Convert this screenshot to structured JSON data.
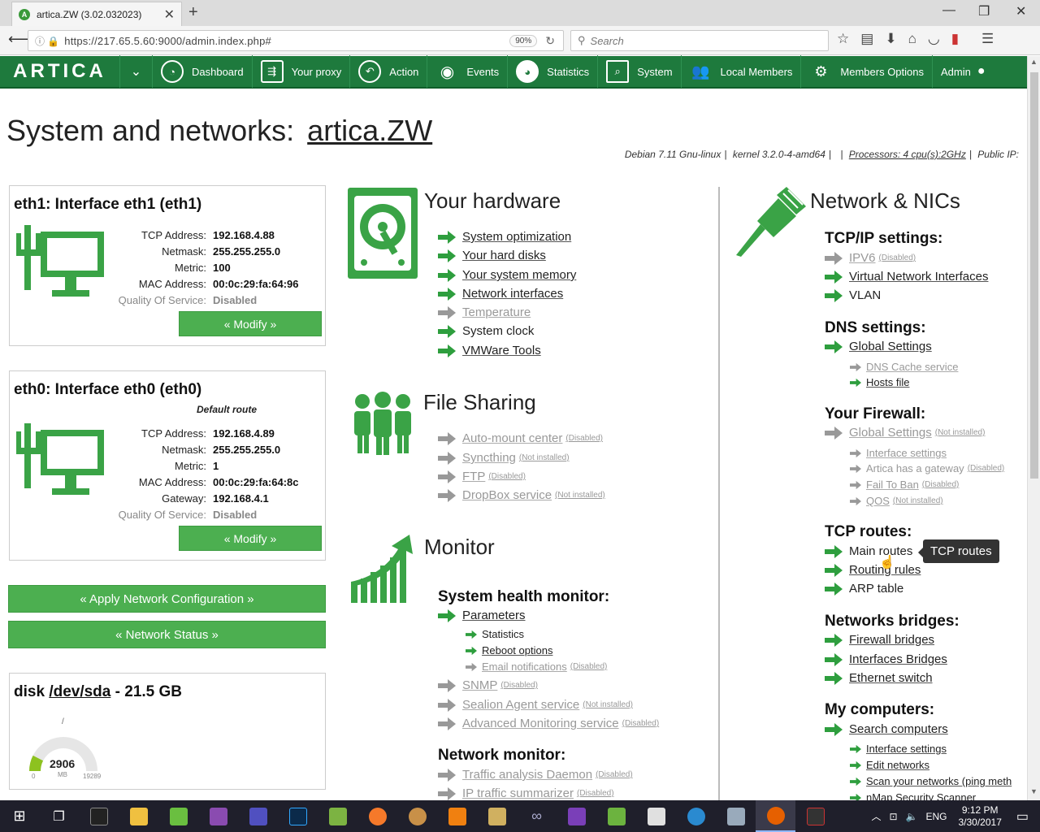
{
  "browser": {
    "tab_title": "artica.ZW (3.02.032023)",
    "url": "https://217.65.5.60:9000/admin.index.php#",
    "zoom": "90%",
    "search_placeholder": "Search"
  },
  "appnav": {
    "logo": "ARTICA",
    "items": [
      {
        "label": "Dashboard",
        "icon": "dashboard-icon"
      },
      {
        "label": "Your proxy",
        "icon": "proxy-icon"
      },
      {
        "label": "Action",
        "icon": "action-icon"
      },
      {
        "label": "Events",
        "icon": "events-icon"
      },
      {
        "label": "Statistics",
        "icon": "statistics-icon"
      },
      {
        "label": "System",
        "icon": "system-icon"
      },
      {
        "label": "Local Members",
        "icon": "local-members-icon"
      },
      {
        "label": "Members Options",
        "icon": "members-options-icon"
      },
      {
        "label": "Admin",
        "icon": "admin-icon"
      }
    ]
  },
  "page": {
    "title_prefix": "System and networks:",
    "hostname": "artica.ZW",
    "sysinfo": {
      "os": "Debian 7.11 Gnu-linux",
      "kernel": "kernel 3.2.0-4-amd64",
      "processors": "Processors: 4 cpu(s):2GHz",
      "public_ip": "Public IP:"
    }
  },
  "eth1": {
    "title": "eth1: Interface eth1 (eth1)",
    "rows": [
      {
        "k": "TCP Address:",
        "v": "192.168.4.88"
      },
      {
        "k": "Netmask:",
        "v": "255.255.255.0"
      },
      {
        "k": "Metric:",
        "v": "100"
      },
      {
        "k": "MAC Address:",
        "v": "00:0c:29:fa:64:96"
      },
      {
        "k": "Quality Of Service:",
        "v": "Disabled"
      }
    ],
    "modify": "« Modify »"
  },
  "eth0": {
    "title": "eth0: Interface eth0 (eth0)",
    "default_route": "Default route",
    "rows": [
      {
        "k": "TCP Address:",
        "v": "192.168.4.89"
      },
      {
        "k": "Netmask:",
        "v": "255.255.255.0"
      },
      {
        "k": "Metric:",
        "v": "1"
      },
      {
        "k": "MAC Address:",
        "v": "00:0c:29:fa:64:8c"
      },
      {
        "k": "Gateway:",
        "v": "192.168.4.1"
      },
      {
        "k": "Quality Of Service:",
        "v": "Disabled"
      }
    ],
    "modify": "« Modify »"
  },
  "buttons": {
    "apply": "« Apply Network Configuration »",
    "status": "« Network Status »"
  },
  "disk": {
    "title_prefix": "disk",
    "device": "/dev/sda",
    "title_suffix": "- 21.5 GB",
    "mount": "/",
    "used": "2906",
    "unit": "MB",
    "min": "0",
    "max": "19289",
    "fill_fraction": 0.15
  },
  "hardware": {
    "title": "Your hardware",
    "links": [
      {
        "label": "System optimization",
        "disabled": false
      },
      {
        "label": "Your hard disks",
        "disabled": false
      },
      {
        "label": "Your system memory",
        "disabled": false
      },
      {
        "label": "Network interfaces",
        "disabled": false
      },
      {
        "label": "Temperature",
        "disabled": true
      },
      {
        "label": "System clock",
        "disabled": false,
        "plain": true
      },
      {
        "label": "VMWare Tools",
        "disabled": false
      }
    ]
  },
  "filesharing": {
    "title": "File Sharing",
    "links": [
      {
        "label": "Auto-mount center",
        "tag": "(Disabled)"
      },
      {
        "label": "Syncthing",
        "tag": "(Not installed)"
      },
      {
        "label": "FTP",
        "tag": "(Disabled)"
      },
      {
        "label": "DropBox service",
        "tag": "(Not installed)"
      }
    ]
  },
  "monitor": {
    "title": "Monitor",
    "health_head": "System health monitor:",
    "parameters": "Parameters",
    "sub": [
      {
        "label": "Statistics",
        "disabled": false,
        "plain": true
      },
      {
        "label": "Reboot options",
        "disabled": false
      },
      {
        "label": "Email notifications",
        "disabled": true,
        "tag": "(Disabled)"
      }
    ],
    "more": [
      {
        "label": "SNMP",
        "tag": "(Disabled)"
      },
      {
        "label": "Sealion Agent service",
        "tag": "(Not installed)"
      },
      {
        "label": "Advanced Monitoring service",
        "tag": "(Disabled)"
      }
    ],
    "network_head": "Network monitor:",
    "net_links": [
      {
        "label": "Traffic analysis Daemon",
        "tag": "(Disabled)"
      },
      {
        "label": "IP traffic summarizer",
        "tag": "(Disabled)"
      }
    ]
  },
  "network": {
    "title": "Network & NICs",
    "tcpip_head": "TCP/IP settings:",
    "tcpip": [
      {
        "label": "IPV6",
        "tag": "(Disabled)",
        "disabled": true
      },
      {
        "label": "Virtual Network Interfaces",
        "disabled": false
      },
      {
        "label": "VLAN",
        "disabled": false,
        "plain": true
      }
    ],
    "dns_head": "DNS settings:",
    "dns_global": "Global Settings",
    "dns_sub": [
      {
        "label": "DNS Cache service",
        "disabled": true
      },
      {
        "label": "Hosts file",
        "disabled": false
      }
    ],
    "fw_head": "Your Firewall:",
    "fw_global": "Global Settings",
    "fw_global_tag": "(Not installed)",
    "fw_sub": [
      {
        "label": "Interface settings",
        "tag": ""
      },
      {
        "label": "Artica has a gateway",
        "tag": "(Disabled)",
        "plain": true
      },
      {
        "label": "Fail To Ban",
        "tag": "(Disabled)"
      },
      {
        "label": "QOS",
        "tag": "(Not installed)"
      }
    ],
    "routes_head": "TCP routes:",
    "routes": [
      {
        "label": "Main routes",
        "plain": true
      },
      {
        "label": "Routing rules"
      },
      {
        "label": "ARP table",
        "plain": true
      }
    ],
    "bridges_head": "Networks bridges:",
    "bridges": [
      {
        "label": "Firewall bridges"
      },
      {
        "label": "Interfaces Bridges"
      },
      {
        "label": "Ethernet switch"
      }
    ],
    "computers_head": "My computers:",
    "search_computers": "Search computers",
    "computers_sub": [
      {
        "label": "Interface settings"
      },
      {
        "label": "Edit networks"
      },
      {
        "label": "Scan your networks (ping meth"
      },
      {
        "label": "nMap Security Scanner"
      }
    ],
    "tooltip": "TCP routes"
  },
  "taskbar": {
    "lang": "ENG",
    "time": "9:12 PM",
    "date": "3/30/2017"
  },
  "colors": {
    "brand_green": "#1e7a3d",
    "button_green": "#4caf50",
    "arrow_green": "#2e9e3e",
    "arrow_disabled": "#999999",
    "gauge_fill": "#8dc21f"
  }
}
